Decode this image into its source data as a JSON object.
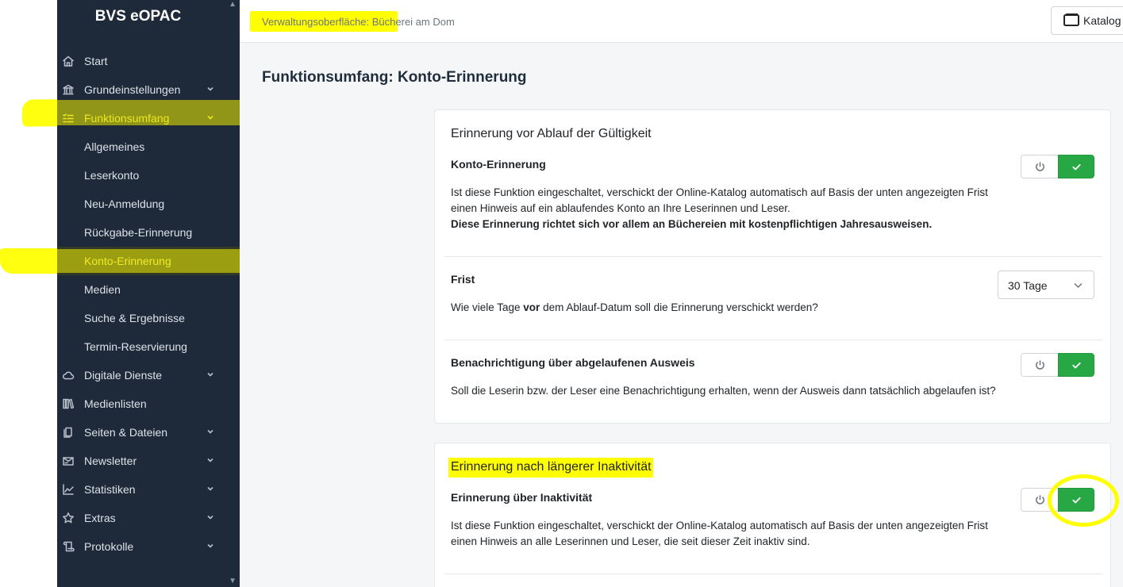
{
  "app": {
    "name": "BVS eOPAC"
  },
  "header": {
    "title": "Verwaltungsoberfläche: Bücherei am Dom",
    "katalog_label": "Katalog"
  },
  "sidebar": {
    "items": [
      {
        "label": "Start",
        "icon": "home-icon"
      },
      {
        "label": "Grundeinstellungen",
        "icon": "bank-icon"
      },
      {
        "label": "Funktionsumfang",
        "icon": "list-check-icon"
      },
      {
        "label": "Allgemeines"
      },
      {
        "label": "Leserkonto"
      },
      {
        "label": "Neu-Anmeldung"
      },
      {
        "label": "Rückgabe-Erinnerung"
      },
      {
        "label": "Konto-Erinnerung"
      },
      {
        "label": "Medien"
      },
      {
        "label": "Suche & Ergebnisse"
      },
      {
        "label": "Termin-Reservierung"
      },
      {
        "label": "Digitale Dienste",
        "icon": "cloud-icon"
      },
      {
        "label": "Medienlisten",
        "icon": "books-icon"
      },
      {
        "label": "Seiten & Dateien",
        "icon": "files-icon"
      },
      {
        "label": "Newsletter",
        "icon": "newsletter-icon"
      },
      {
        "label": "Statistiken",
        "icon": "chart-line-icon"
      },
      {
        "label": "Extras",
        "icon": "star-icon"
      },
      {
        "label": "Protokolle",
        "icon": "scroll-icon"
      }
    ]
  },
  "main": {
    "page_title": "Funktionsumfang: Konto-Erinnerung",
    "card1": {
      "title": "Erinnerung vor Ablauf der Gültigkeit",
      "konto": {
        "title": "Konto-Erinnerung",
        "text_line1": "Ist diese Funktion eingeschaltet, verschickt der Online-Katalog automatisch auf Basis der unten angezeigten Frist",
        "text_line2": "einen Hinweis auf ein ablaufendes Konto an Ihre Leserinnen und Leser.",
        "text_bold": "Diese Erinnerung richtet sich vor allem an Büchereien mit kostenpflichtigen Jahresausweisen.",
        "enabled": true
      },
      "frist": {
        "title": "Frist",
        "text_before": "Wie viele Tage ",
        "text_bold": "vor",
        "text_after": " dem Ablauf-Datum soll die Erinnerung verschickt werden?",
        "selected": "30 Tage"
      },
      "benachrichtigung": {
        "title": "Benachrichtigung über abgelaufenen Ausweis",
        "text": "Soll die Leserin bzw. der Leser eine Benachrichtigung erhalten, wenn der Ausweis dann tatsächlich abgelaufen ist?",
        "enabled": true
      }
    },
    "card2": {
      "title": "Erinnerung nach längerer Inaktivität",
      "inaktiv": {
        "title": "Erinnerung über Inaktivität",
        "text_line1": "Ist diese Funktion eingeschaltet, verschickt der Online-Katalog automatisch auf Basis der unten angezeigten Frist",
        "text_line2": "einen Hinweis an alle Leserinnen und Leser, die seit dieser Zeit inaktiv sind.",
        "enabled": true
      }
    }
  },
  "colors": {
    "sidebar_bg": "#1e2939",
    "active_text": "#e9df3c",
    "toggle_on": "#28a745",
    "highlighter": "#ffff00"
  }
}
